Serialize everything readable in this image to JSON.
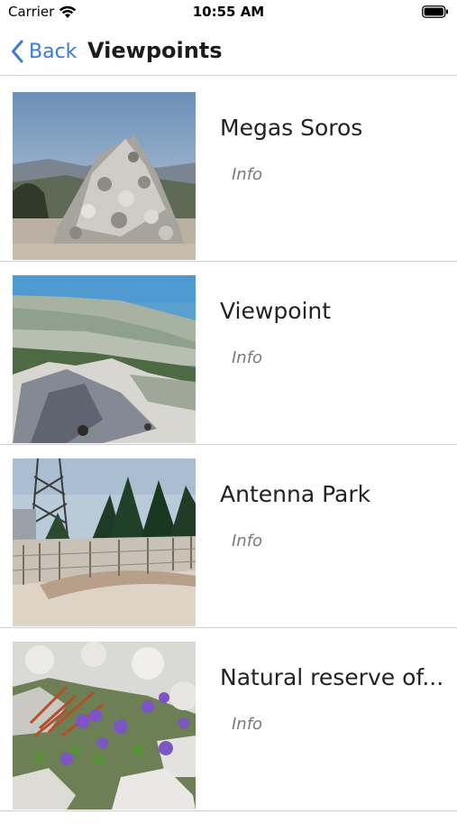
{
  "status": {
    "carrier": "Carrier",
    "time": "10:55 AM"
  },
  "nav": {
    "back_label": "Back",
    "title": "Viewpoints"
  },
  "items": [
    {
      "title": "Megas Soros",
      "info": "Info",
      "image": "stone-cairn-photo"
    },
    {
      "title": "Viewpoint",
      "info": "Info",
      "image": "coastal-viewpoint-photo"
    },
    {
      "title": "Antenna Park",
      "info": "Info",
      "image": "antenna-park-photo"
    },
    {
      "title": "Natural reserve of...",
      "info": "Info",
      "image": "wild-flowers-photo"
    }
  ],
  "colors": {
    "accent": "#3a7bd5",
    "divider": "#cfcfcf"
  }
}
